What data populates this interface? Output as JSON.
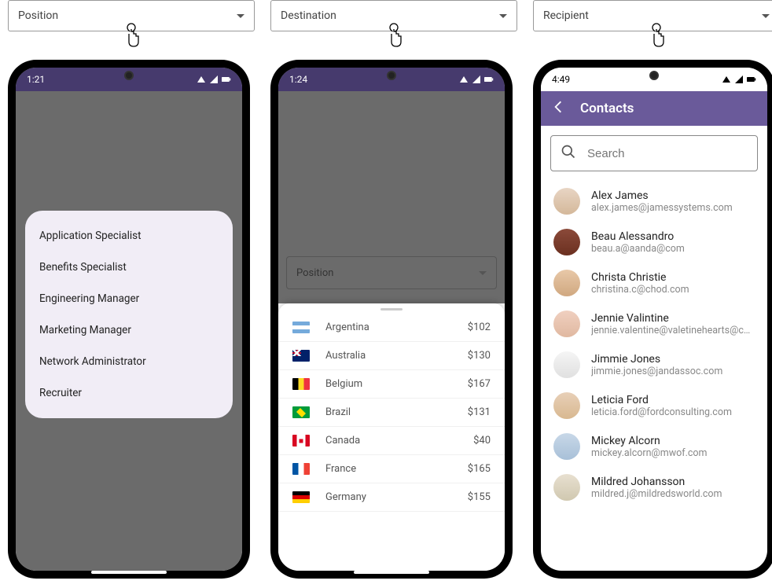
{
  "dropdowns": [
    {
      "label": "Position"
    },
    {
      "label": "Destination"
    },
    {
      "label": "Recipient"
    }
  ],
  "phone1": {
    "time": "1:21",
    "popup_items": [
      "Application Specialist",
      "Benefits Specialist",
      "Engineering Manager",
      "Marketing Manager",
      "Network Administrator",
      "Recruiter"
    ]
  },
  "phone2": {
    "time": "1:24",
    "field_label": "Position",
    "countries": [
      {
        "name": "Argentina",
        "price": "$102",
        "flag": "flag-ar"
      },
      {
        "name": "Australia",
        "price": "$130",
        "flag": "flag-au"
      },
      {
        "name": "Belgium",
        "price": "$167",
        "flag": "flag-be"
      },
      {
        "name": "Brazil",
        "price": "$131",
        "flag": "flag-br"
      },
      {
        "name": "Canada",
        "price": "$40",
        "flag": "flag-ca"
      },
      {
        "name": "France",
        "price": "$165",
        "flag": "flag-fr"
      },
      {
        "name": "Germany",
        "price": "$155",
        "flag": "flag-de"
      }
    ]
  },
  "phone3": {
    "time": "4:49",
    "title": "Contacts",
    "search_placeholder": "Search",
    "contacts": [
      {
        "name": "Alex James",
        "email": "alex.james@jamessystems.com",
        "av": "av0"
      },
      {
        "name": "Beau Alessandro",
        "email": "beau.a@aanda@com",
        "av": "av1"
      },
      {
        "name": "Christa Christie",
        "email": "christina.c@chod.com",
        "av": "av2"
      },
      {
        "name": "Jennie Valintine",
        "email": "jennie.valentine@valetinehearts@com",
        "av": "av3"
      },
      {
        "name": "Jimmie Jones",
        "email": "jimmie.jones@jandassoc.com",
        "av": "av4"
      },
      {
        "name": "Leticia Ford",
        "email": "leticia.ford@fordconsulting.com",
        "av": "av5"
      },
      {
        "name": "Mickey Alcorn",
        "email": "mickey.alcorn@mwof.com",
        "av": "av6"
      },
      {
        "name": "Mildred Johansson",
        "email": "mildred.j@mildredsworld.com",
        "av": "av7"
      }
    ]
  }
}
